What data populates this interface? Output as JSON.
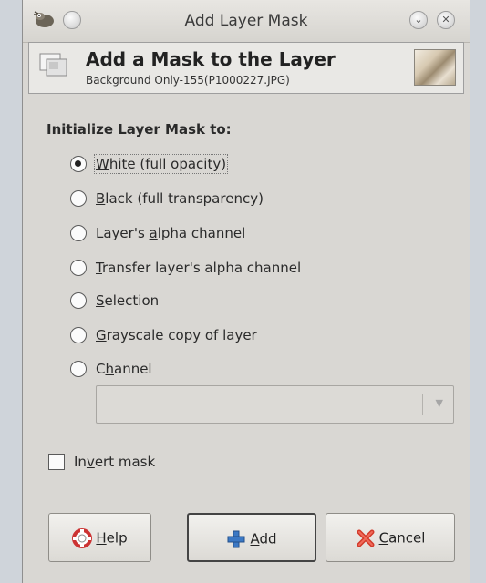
{
  "window": {
    "title": "Add Layer Mask"
  },
  "header": {
    "title": "Add a Mask to the Layer",
    "subtitle": "Background Only-155(P1000227.JPG)"
  },
  "section": {
    "title": "Initialize Layer Mask to:"
  },
  "options": [
    {
      "pre": "",
      "mn": "W",
      "post": "hite (full opacity)",
      "selected": true
    },
    {
      "pre": "",
      "mn": "B",
      "post": "lack (full transparency)",
      "selected": false
    },
    {
      "pre": "Layer's ",
      "mn": "a",
      "post": "lpha channel",
      "selected": false
    },
    {
      "pre": "",
      "mn": "T",
      "post": "ransfer layer's alpha channel",
      "selected": false
    },
    {
      "pre": "",
      "mn": "S",
      "post": "election",
      "selected": false
    },
    {
      "pre": "",
      "mn": "G",
      "post": "rayscale copy of layer",
      "selected": false
    },
    {
      "pre": "C",
      "mn": "h",
      "post": "annel",
      "selected": false
    }
  ],
  "channel_select": {
    "value": ""
  },
  "invert": {
    "pre": "In",
    "mn": "v",
    "post": "ert mask",
    "checked": false
  },
  "buttons": {
    "help": {
      "mn": "H",
      "post": "elp",
      "icon": "lifebuoy-icon"
    },
    "add": {
      "mn": "A",
      "post": "dd",
      "icon": "plus-icon"
    },
    "cancel": {
      "mn": "C",
      "post": "ancel",
      "icon": "red-x-icon"
    }
  },
  "colors": {
    "dialog_bg": "#d9d7d3",
    "header_bg": "#e9e8e5",
    "add_icon": "#3b78c4",
    "cancel_icon": "#d23a2a",
    "help_icon": "#d6463a"
  }
}
